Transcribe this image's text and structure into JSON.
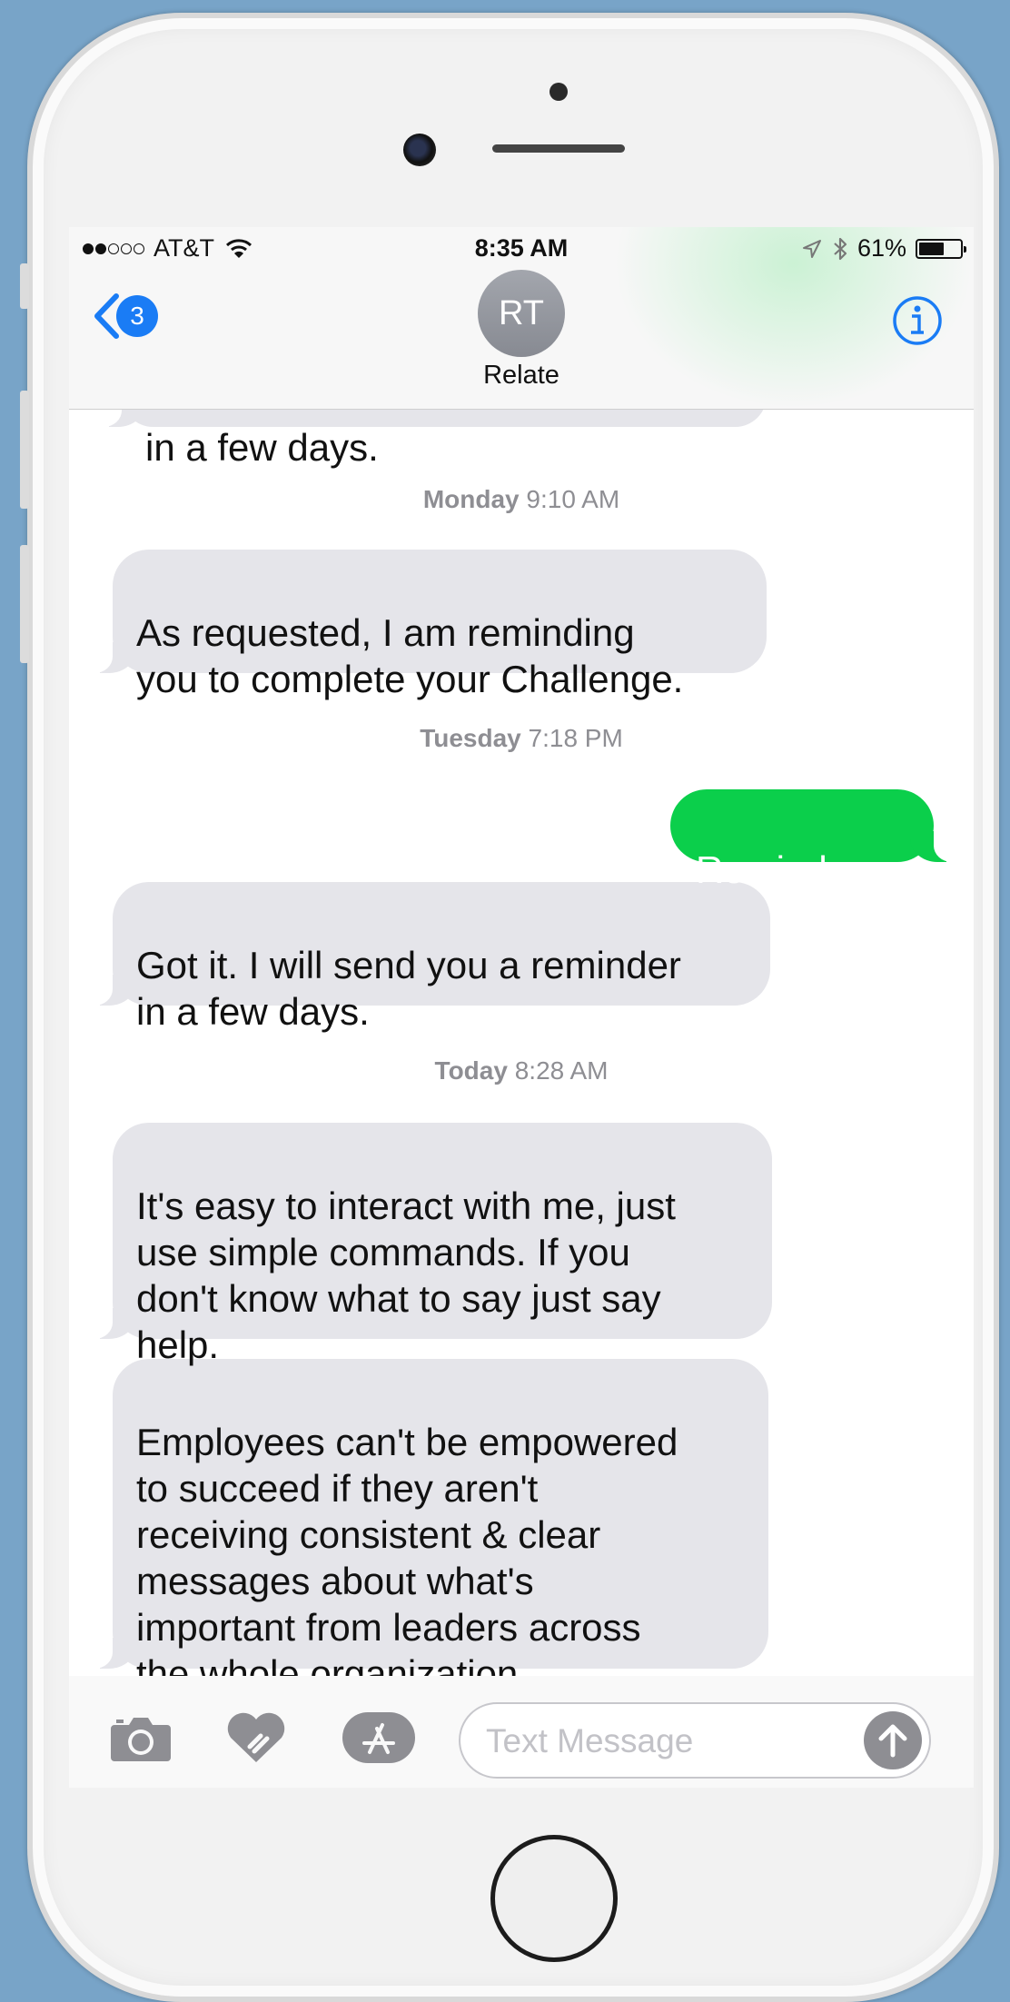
{
  "status_bar": {
    "carrier": "AT&T",
    "time": "8:35 AM",
    "battery": "61%",
    "battery_level": 0.61,
    "signal_bars_filled": 2,
    "signal_bars_total": 5
  },
  "header": {
    "back_badge_count": "3",
    "avatar_initials": "RT",
    "contact_name": "Relate"
  },
  "thread": {
    "partial_top_message": "in a few days.",
    "items": [
      {
        "kind": "timestamp",
        "day": "Monday",
        "time": "9:10 AM"
      },
      {
        "kind": "incoming",
        "text": "As requested, I am reminding\nyou to complete your Challenge."
      },
      {
        "kind": "timestamp",
        "day": "Tuesday",
        "time": "7:18 PM"
      },
      {
        "kind": "outgoing",
        "text": "Remind me"
      },
      {
        "kind": "incoming",
        "text": "Got it. I will send you a reminder\nin a few days."
      },
      {
        "kind": "timestamp",
        "day": "Today",
        "time": "8:28 AM"
      },
      {
        "kind": "incoming",
        "text": "It's easy to interact with me, just\nuse simple commands. If you\ndon't know what to say just say\nhelp."
      },
      {
        "kind": "incoming",
        "text": "Employees can't be empowered\nto succeed if they aren't\nreceiving consistent & clear\nmessages about what's\nimportant from leaders across\nthe whole organization."
      }
    ]
  },
  "composer": {
    "placeholder": "Text Message",
    "icons": [
      "camera-icon",
      "digital-touch-icon",
      "app-store-icon",
      "send-arrow-icon"
    ]
  },
  "colors": {
    "outgoing_bubble": "#0bcf4b",
    "incoming_bubble": "#e5e5ea",
    "ios_blue": "#1a7cf5",
    "background": "#78a4c8"
  }
}
